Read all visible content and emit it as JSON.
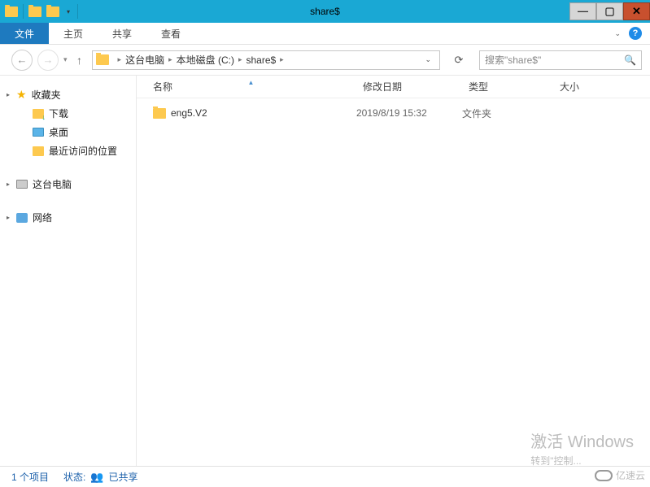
{
  "window": {
    "title": "share$"
  },
  "ribbon": {
    "file": "文件",
    "tabs": [
      "主页",
      "共享",
      "查看"
    ]
  },
  "nav": {
    "breadcrumb": [
      "这台电脑",
      "本地磁盘 (C:)",
      "share$"
    ]
  },
  "search": {
    "placeholder": "搜索\"share$\""
  },
  "sidebar": {
    "favorites": {
      "label": "收藏夹",
      "items": [
        "下载",
        "桌面",
        "最近访问的位置"
      ]
    },
    "thispc": {
      "label": "这台电脑"
    },
    "network": {
      "label": "网络"
    }
  },
  "columns": {
    "name": "名称",
    "date": "修改日期",
    "type": "类型",
    "size": "大小"
  },
  "items": [
    {
      "name": "eng5.V2",
      "date": "2019/8/19 15:32",
      "type": "文件夹",
      "size": ""
    }
  ],
  "status": {
    "count": "1 个项目",
    "state_label": "状态:",
    "state": "已共享"
  },
  "watermark": {
    "title": "激活 Windows",
    "sub": "转到\"控制..."
  },
  "cloud": {
    "text": "亿速云"
  }
}
